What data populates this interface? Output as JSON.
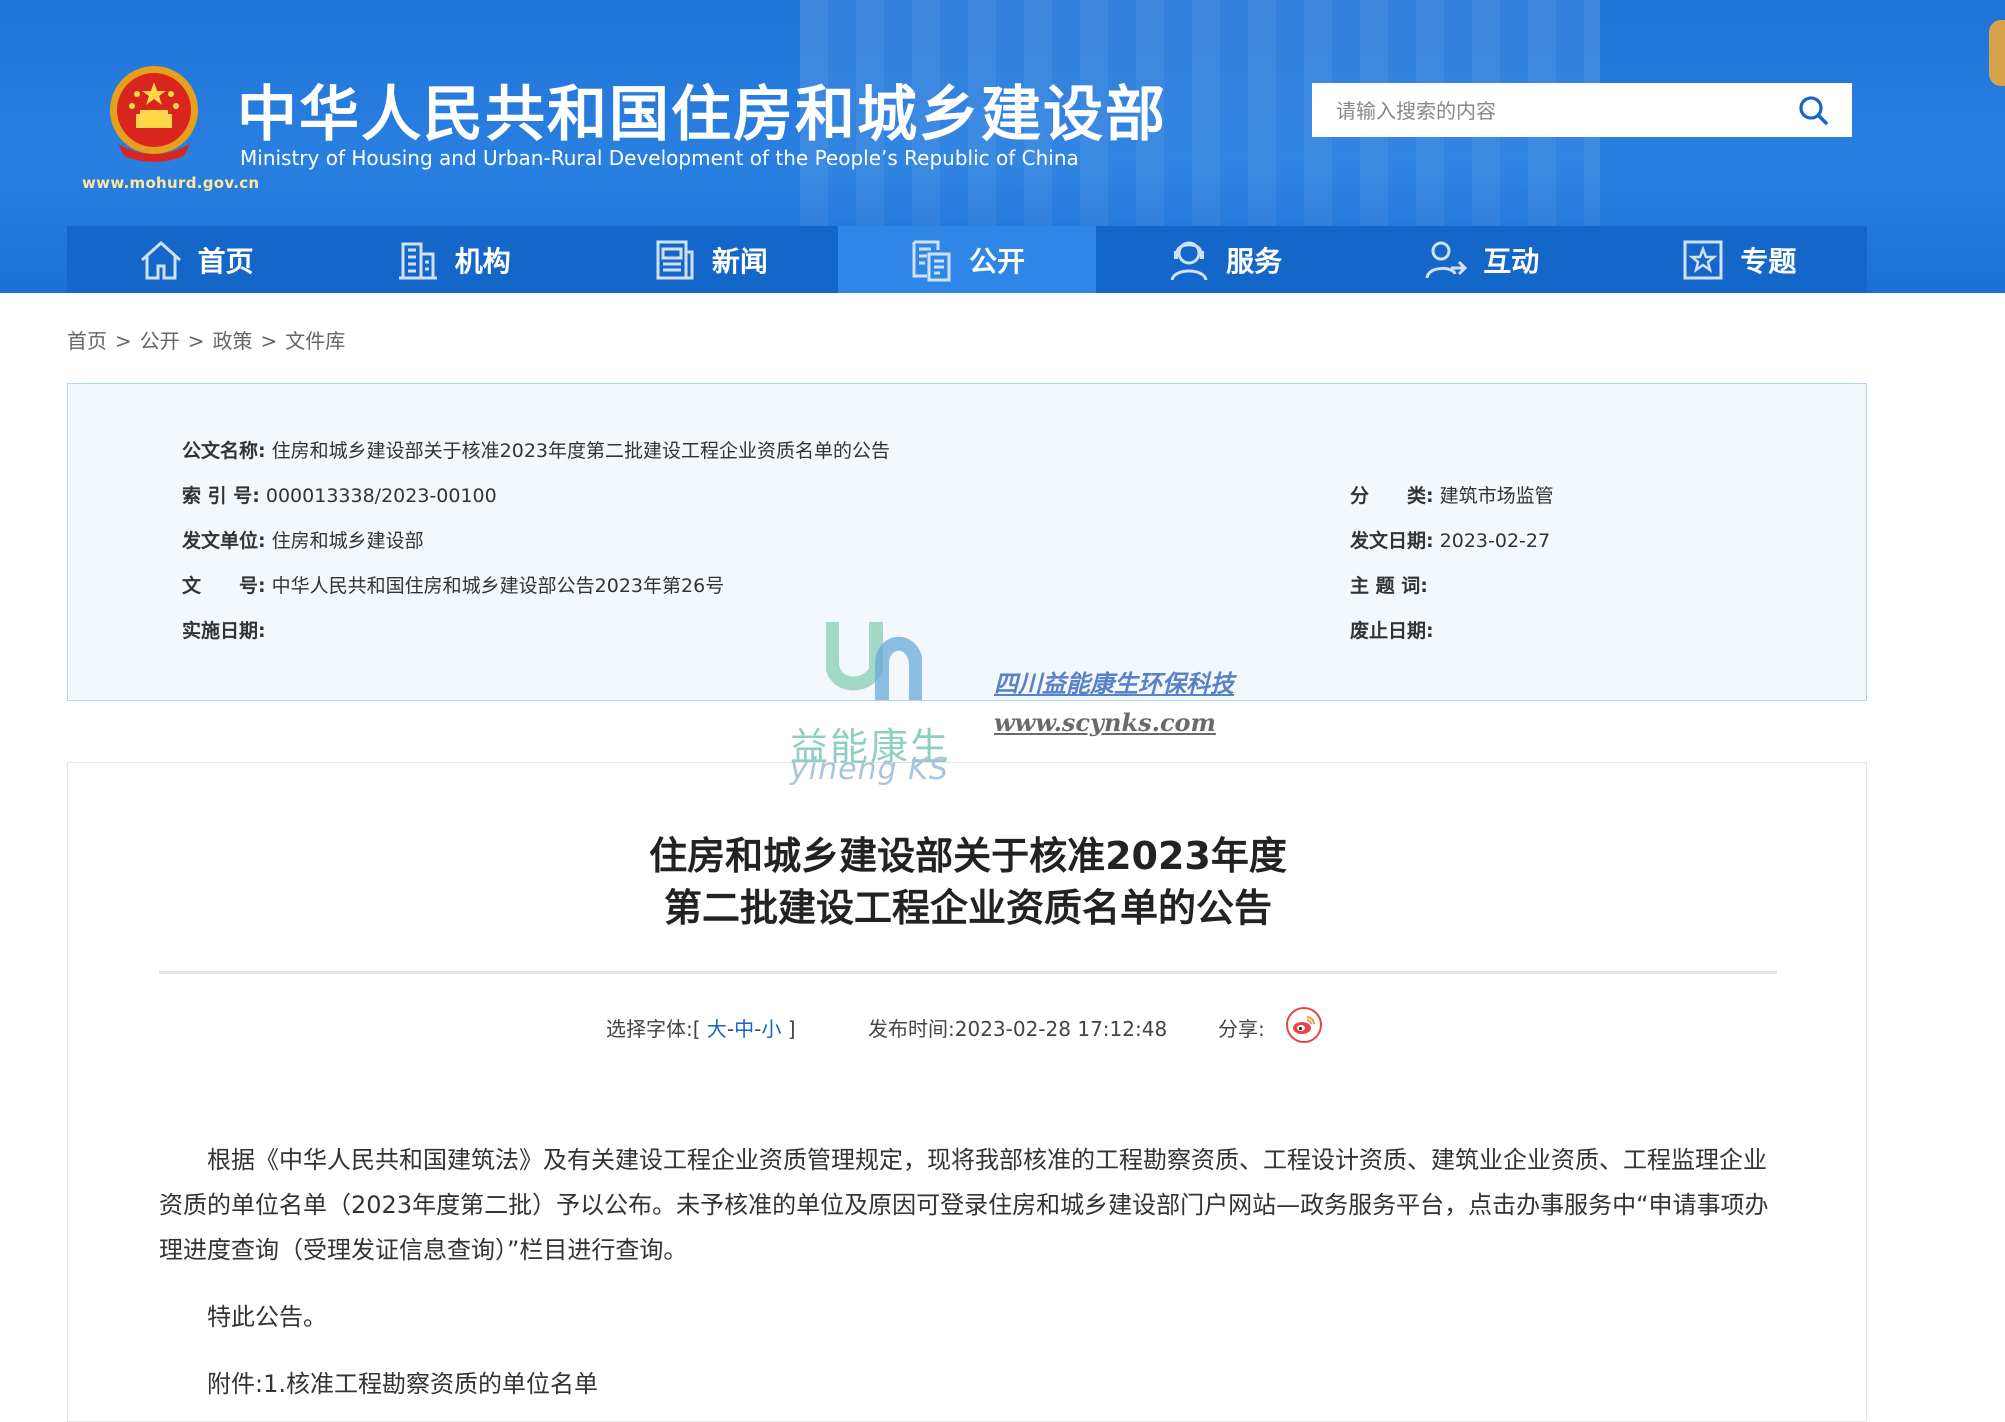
{
  "header": {
    "title_cn": "中华人民共和国住房和城乡建设部",
    "title_en": "Ministry of Housing and Urban-Rural Development of the People’s Republic of China",
    "site_url": "www.mohurd.gov.cn",
    "search_placeholder": "请输入搜索的内容"
  },
  "nav": {
    "items": [
      {
        "label": "首页"
      },
      {
        "label": "机构"
      },
      {
        "label": "新闻"
      },
      {
        "label": "公开"
      },
      {
        "label": "服务"
      },
      {
        "label": "互动"
      },
      {
        "label": "专题"
      }
    ],
    "active": "公开"
  },
  "breadcrumb": [
    "首页",
    "公开",
    "政策",
    "文件库"
  ],
  "breadcrumb_sep": ">",
  "meta": {
    "doc_name_label": "公文名称:",
    "doc_name": "住房和城乡建设部关于核准2023年度第二批建设工程企业资质名单的公告",
    "index_label": "索 引 号:",
    "index": "000013338/2023-00100",
    "category_label": "分　　类:",
    "category": "建筑市场监管",
    "issuer_label": "发文单位:",
    "issuer": "住房和城乡建设部",
    "issue_date_label": "发文日期:",
    "issue_date": "2023-02-27",
    "doc_no_label": "文　　号:",
    "doc_no": "中华人民共和国住房和城乡建设部公告2023年第26号",
    "subject_label": "主 题 词:",
    "subject": "",
    "effective_label": "实施日期:",
    "effective": "",
    "abolish_label": "废止日期:",
    "abolish": ""
  },
  "watermark": {
    "company": "四川益能康生环保科技",
    "url": "www.scynks.com",
    "brand_cn": "益能康生",
    "brand_en": "yineng KS"
  },
  "article": {
    "title_line1": "住房和城乡建设部关于核准2023年度",
    "title_line2": "第二批建设工程企业资质名单的公告",
    "font_label": "选择字体:",
    "bracket_open": "[",
    "bracket_close": "]",
    "font_large": "大",
    "font_medium": "中",
    "font_small": "小",
    "dash": "-",
    "publish_label": "发布时间:",
    "publish_time": "2023-02-28 17:12:48",
    "share_label": "分享:",
    "paragraph1": "根据《中华人民共和国建筑法》及有关建设工程企业资质管理规定，现将我部核准的工程勘察资质、工程设计资质、建筑业企业资质、工程监理企业资质的单位名单（2023年度第二批）予以公布。未予核准的单位及原因可登录住房和城乡建设部门户网站—政务服务平台，点击办事服务中“申请事项办理进度查询（受理发证信息查询）”栏目进行查询。",
    "paragraph2": "特此公告。",
    "attachment_label": "附件:",
    "attachment1": "1.核准工程勘察资质的单位名单"
  },
  "colors": {
    "header_blue": "#1f73d8",
    "nav_blue": "#1566c9",
    "nav_active": "#2f86e6",
    "link_blue": "#1a63c2",
    "weibo_red": "#e8454a"
  }
}
